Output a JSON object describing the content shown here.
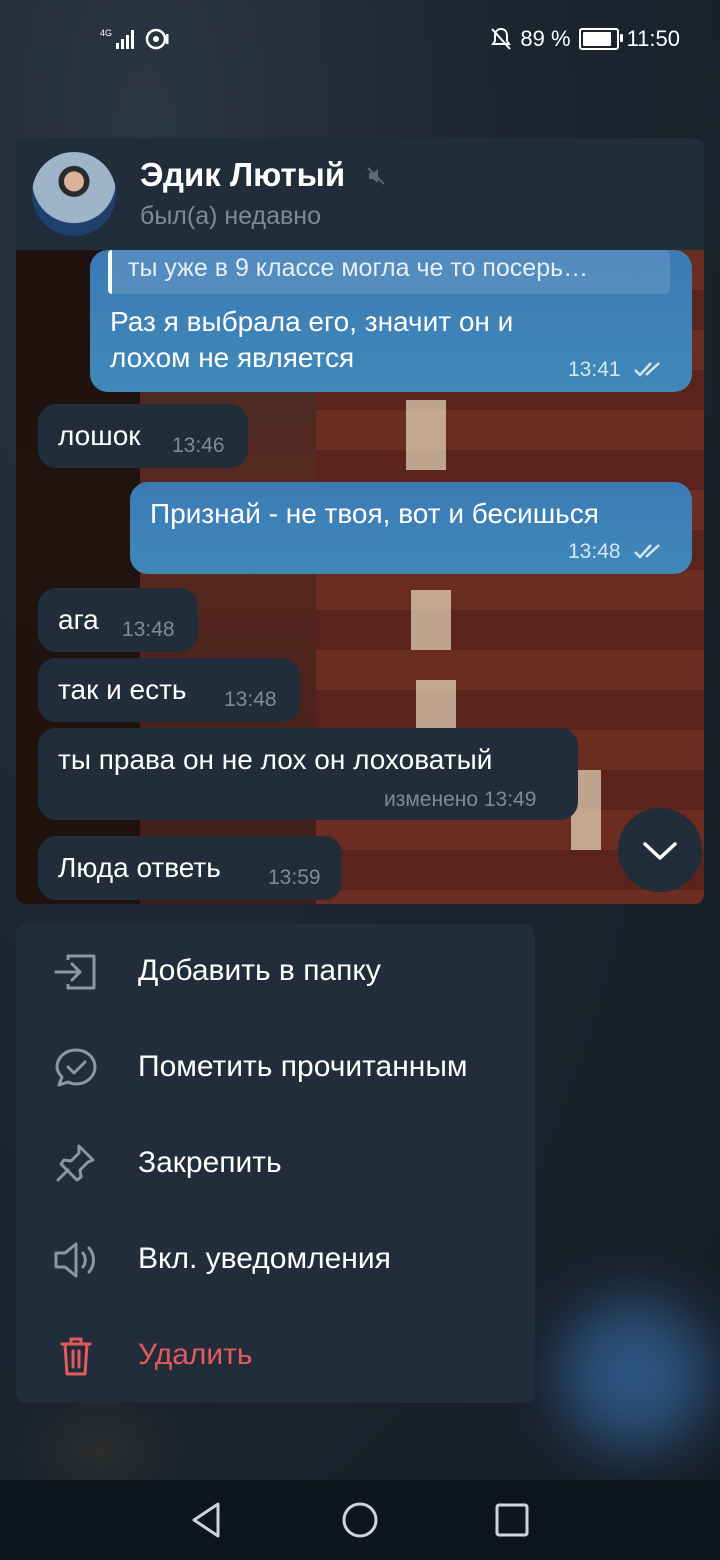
{
  "status_bar": {
    "network": "4G",
    "battery_percent": "89 %",
    "battery_level": 0.89,
    "time": "11:50"
  },
  "chat": {
    "contact_name": "Эдик Лютый",
    "contact_status": "был(а) недавно",
    "messages": [
      {
        "direction": "out",
        "reply_quote": "ты уже в 9 классе могла че то посерь…",
        "text_lines": [
          "Раз я выбрала его, значит он и",
          "лохом не является"
        ],
        "time": "13:41",
        "read": true
      },
      {
        "direction": "in",
        "text": "лошок",
        "time": "13:46"
      },
      {
        "direction": "out",
        "text": "Признай - не твоя, вот и бесишься",
        "time": "13:48",
        "read": true
      },
      {
        "direction": "in",
        "text": "ага",
        "time": "13:48"
      },
      {
        "direction": "in",
        "text": "так и есть",
        "time": "13:48"
      },
      {
        "direction": "in",
        "text": "ты права он не лох он лоховатый",
        "time": "изменено 13:49"
      },
      {
        "direction": "in",
        "text": "Люда ответь",
        "time": "13:59"
      }
    ]
  },
  "menu": {
    "items": [
      {
        "label": "Добавить в папку",
        "icon": "folder-add-icon"
      },
      {
        "label": "Пометить прочитанным",
        "icon": "mark-read-icon"
      },
      {
        "label": "Закрепить",
        "icon": "pin-icon"
      },
      {
        "label": "Вкл. уведомления",
        "icon": "speaker-icon"
      },
      {
        "label": "Удалить",
        "icon": "trash-icon",
        "danger": true
      }
    ],
    "danger_color": "#e35b5b"
  },
  "colors": {
    "incoming_bubble": "#212d3b",
    "outgoing_bubble": "#3f88b8",
    "menu_bg": "#212d3b"
  }
}
